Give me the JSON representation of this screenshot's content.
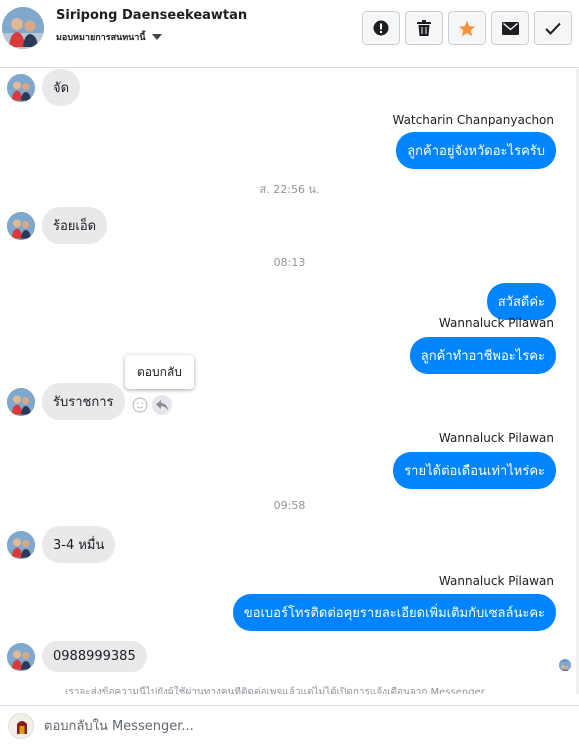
{
  "header": {
    "contact_name": "Siripong Daenseekeawtan",
    "assign_label": "มอบหมายการสนทนานี้",
    "actions": [
      {
        "name": "mark-spam",
        "icon": "exclamation-icon"
      },
      {
        "name": "delete",
        "icon": "trash-icon"
      },
      {
        "name": "star",
        "icon": "star-icon",
        "color": "#f7923a"
      },
      {
        "name": "mark-unread",
        "icon": "envelope-icon"
      },
      {
        "name": "mark-done",
        "icon": "check-icon"
      }
    ]
  },
  "colors": {
    "outgoing_bubble": "#0084ff",
    "incoming_bubble": "#e9e9eb",
    "timestamp": "#90949c"
  },
  "messages": [
    {
      "direction": "in",
      "text": "จัด"
    },
    {
      "direction": "out",
      "sender": "Watcharin Chanpanyachon",
      "text": "ลูกค้าอยู่จังหวัดอะไรครับ"
    },
    {
      "type": "time",
      "text": "ส. 22:56 น."
    },
    {
      "direction": "in",
      "text": "ร้อยเอ็ด"
    },
    {
      "type": "time",
      "text": "08:13"
    },
    {
      "direction": "out",
      "text": "สวัสดีค่ะ"
    },
    {
      "direction": "out",
      "sender": "Wannaluck Pilawan",
      "text": "ลูกค้าทำอาชีพอะไรคะ"
    },
    {
      "direction": "in",
      "text": "รับราชการ"
    },
    {
      "direction": "out",
      "sender": "Wannaluck Pilawan",
      "text": "รายได้ต่อเดือนเท่าไหร่คะ"
    },
    {
      "type": "time",
      "text": "09:58"
    },
    {
      "direction": "in",
      "text": "3-4 หมื่น"
    },
    {
      "direction": "out",
      "sender": "Wannaluck Pilawan",
      "text": "ขอเบอร์โทรติดต่อคุยรายละเอียดเพิ่มเติมกับเซลล์นะคะ"
    },
    {
      "direction": "in",
      "text": "0988999385"
    }
  ],
  "tooltip": {
    "text": "ตอบกลับ"
  },
  "notice": {
    "text": "เราจะส่งข้อความนี้ไปยังผู้ใช้ผ่านทางคนที่ติดต่อเพจแล้วแต่ไม่ได้เปิดการแจ้งเตือนจาก Messenger"
  },
  "composer": {
    "placeholder": "ตอบกลับใน Messenger..."
  }
}
